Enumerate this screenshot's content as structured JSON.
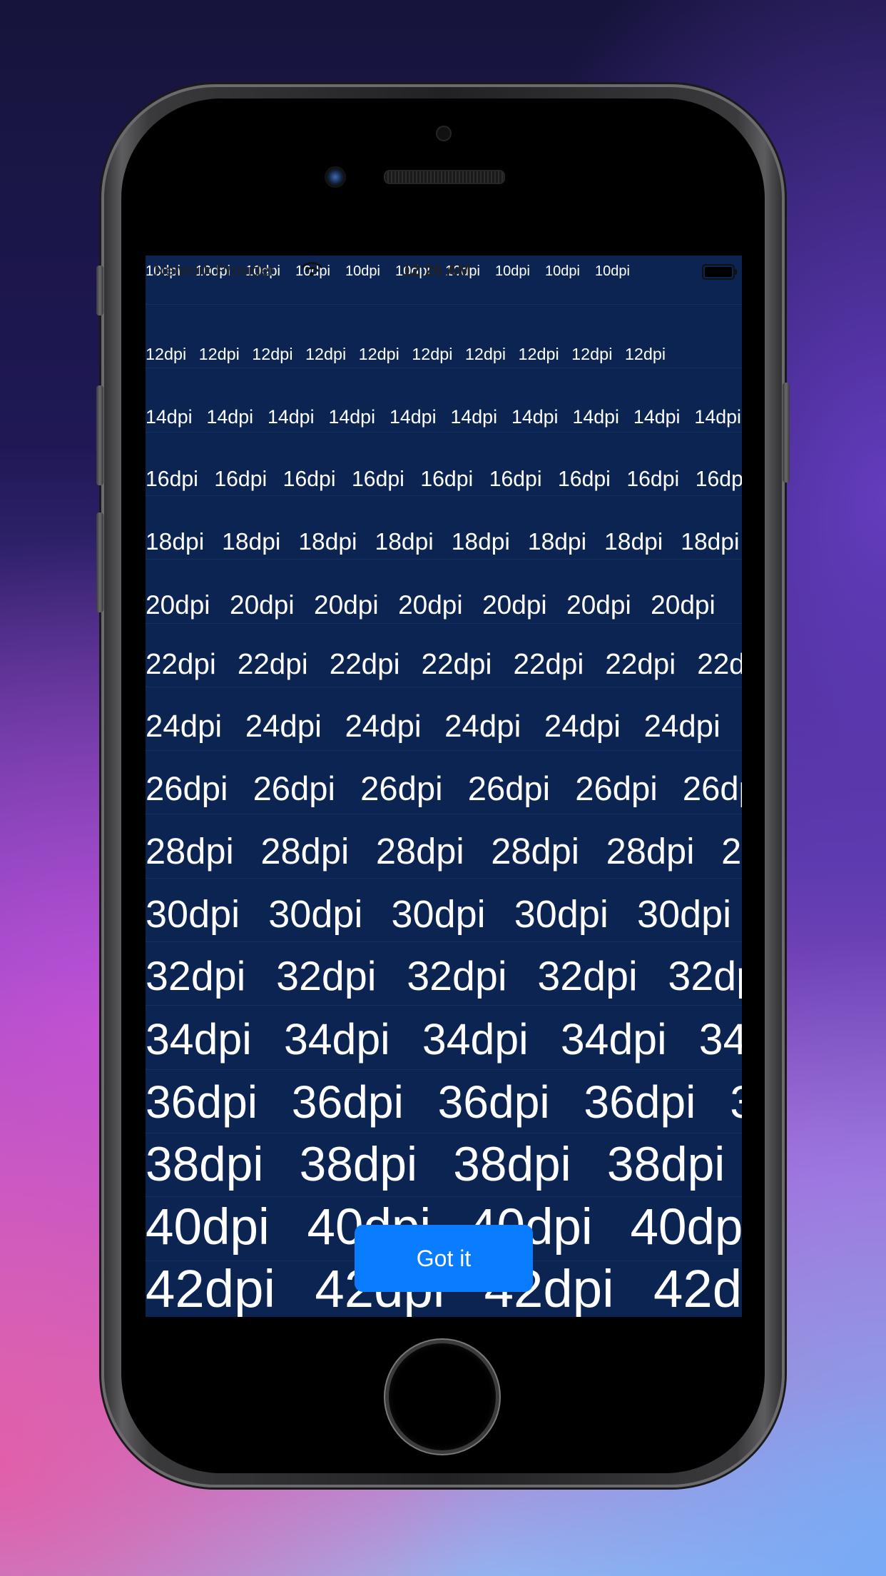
{
  "status_bar": {
    "carrier": "Network Provider",
    "time": "12:26 AM",
    "wifi_icon": "wifi-icon",
    "battery_icon": "battery-icon"
  },
  "rows": [
    {
      "label": "10dpi",
      "count": 10
    },
    {
      "label": "12dpi",
      "count": 10
    },
    {
      "label": "14dpi",
      "count": 10
    },
    {
      "label": "16dpi",
      "count": 9
    },
    {
      "label": "18dpi",
      "count": 8
    },
    {
      "label": "20dpi",
      "count": 7
    },
    {
      "label": "22dpi",
      "count": 7
    },
    {
      "label": "24dpi",
      "count": 6
    },
    {
      "label": "26dpi",
      "count": 6
    },
    {
      "label": "28dpi",
      "count": 6
    },
    {
      "label": "30dpi",
      "count": 5
    },
    {
      "label": "32dpi",
      "count": 5
    },
    {
      "label": "34dpi",
      "count": 5
    },
    {
      "label": "36dpi",
      "count": 5
    },
    {
      "label": "38dpi",
      "count": 4
    },
    {
      "label": "40dpi",
      "count": 4
    },
    {
      "label": "42dpi",
      "count": 4
    }
  ],
  "dismiss_button": {
    "label": "Got it"
  },
  "colors": {
    "screen_background": "#0c2452",
    "button": "#0a7cff",
    "text": "#ffffff"
  }
}
